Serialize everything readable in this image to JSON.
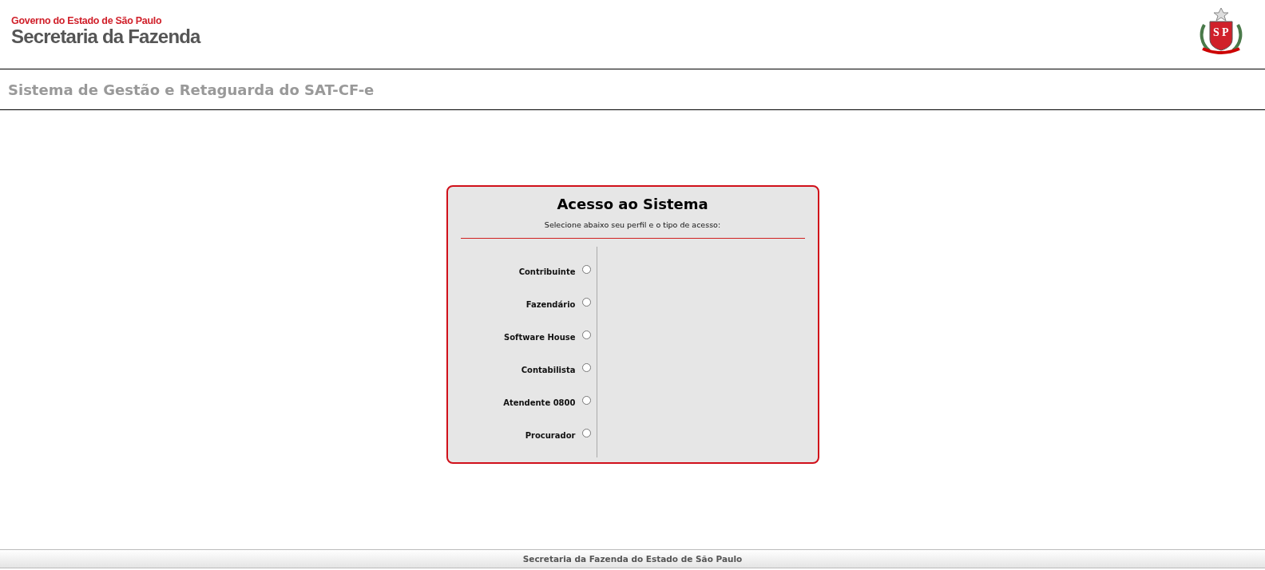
{
  "header": {
    "government": "Governo do Estado de São Paulo",
    "department": "Secretaria da Fazenda",
    "emblem_letters": [
      "S",
      "P"
    ]
  },
  "system_title": "Sistema de Gestão e Retaguarda do SAT-CF-e",
  "login": {
    "title": "Acesso ao Sistema",
    "instruction": "Selecione abaixo seu perfil e o tipo de acesso:",
    "profiles": [
      {
        "label": "Contribuinte",
        "selected": false
      },
      {
        "label": "Fazendário",
        "selected": false
      },
      {
        "label": "Software House",
        "selected": false
      },
      {
        "label": "Contabilista",
        "selected": false
      },
      {
        "label": "Atendente 0800",
        "selected": false
      },
      {
        "label": "Procurador",
        "selected": false
      }
    ]
  },
  "footer": "Secretaria da Fazenda do Estado de São Paulo"
}
